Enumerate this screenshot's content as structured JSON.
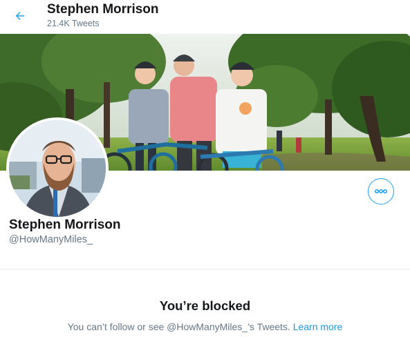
{
  "header": {
    "title": "Stephen Morrison",
    "tweet_count": "21.4K Tweets"
  },
  "profile": {
    "name": "Stephen Morrison",
    "handle": "@HowManyMiles_"
  },
  "blocked": {
    "title": "You’re blocked",
    "description": "You can’t follow or see @HowManyMiles_’s Tweets.",
    "link_label": "Learn more"
  },
  "icons": {
    "back": "arrow-left-icon",
    "more": "more-horizontal-icon"
  },
  "colors": {
    "accent": "#1da1f2",
    "text_primary": "#14171a",
    "text_secondary": "#657786",
    "divider": "#e6ecf0"
  }
}
